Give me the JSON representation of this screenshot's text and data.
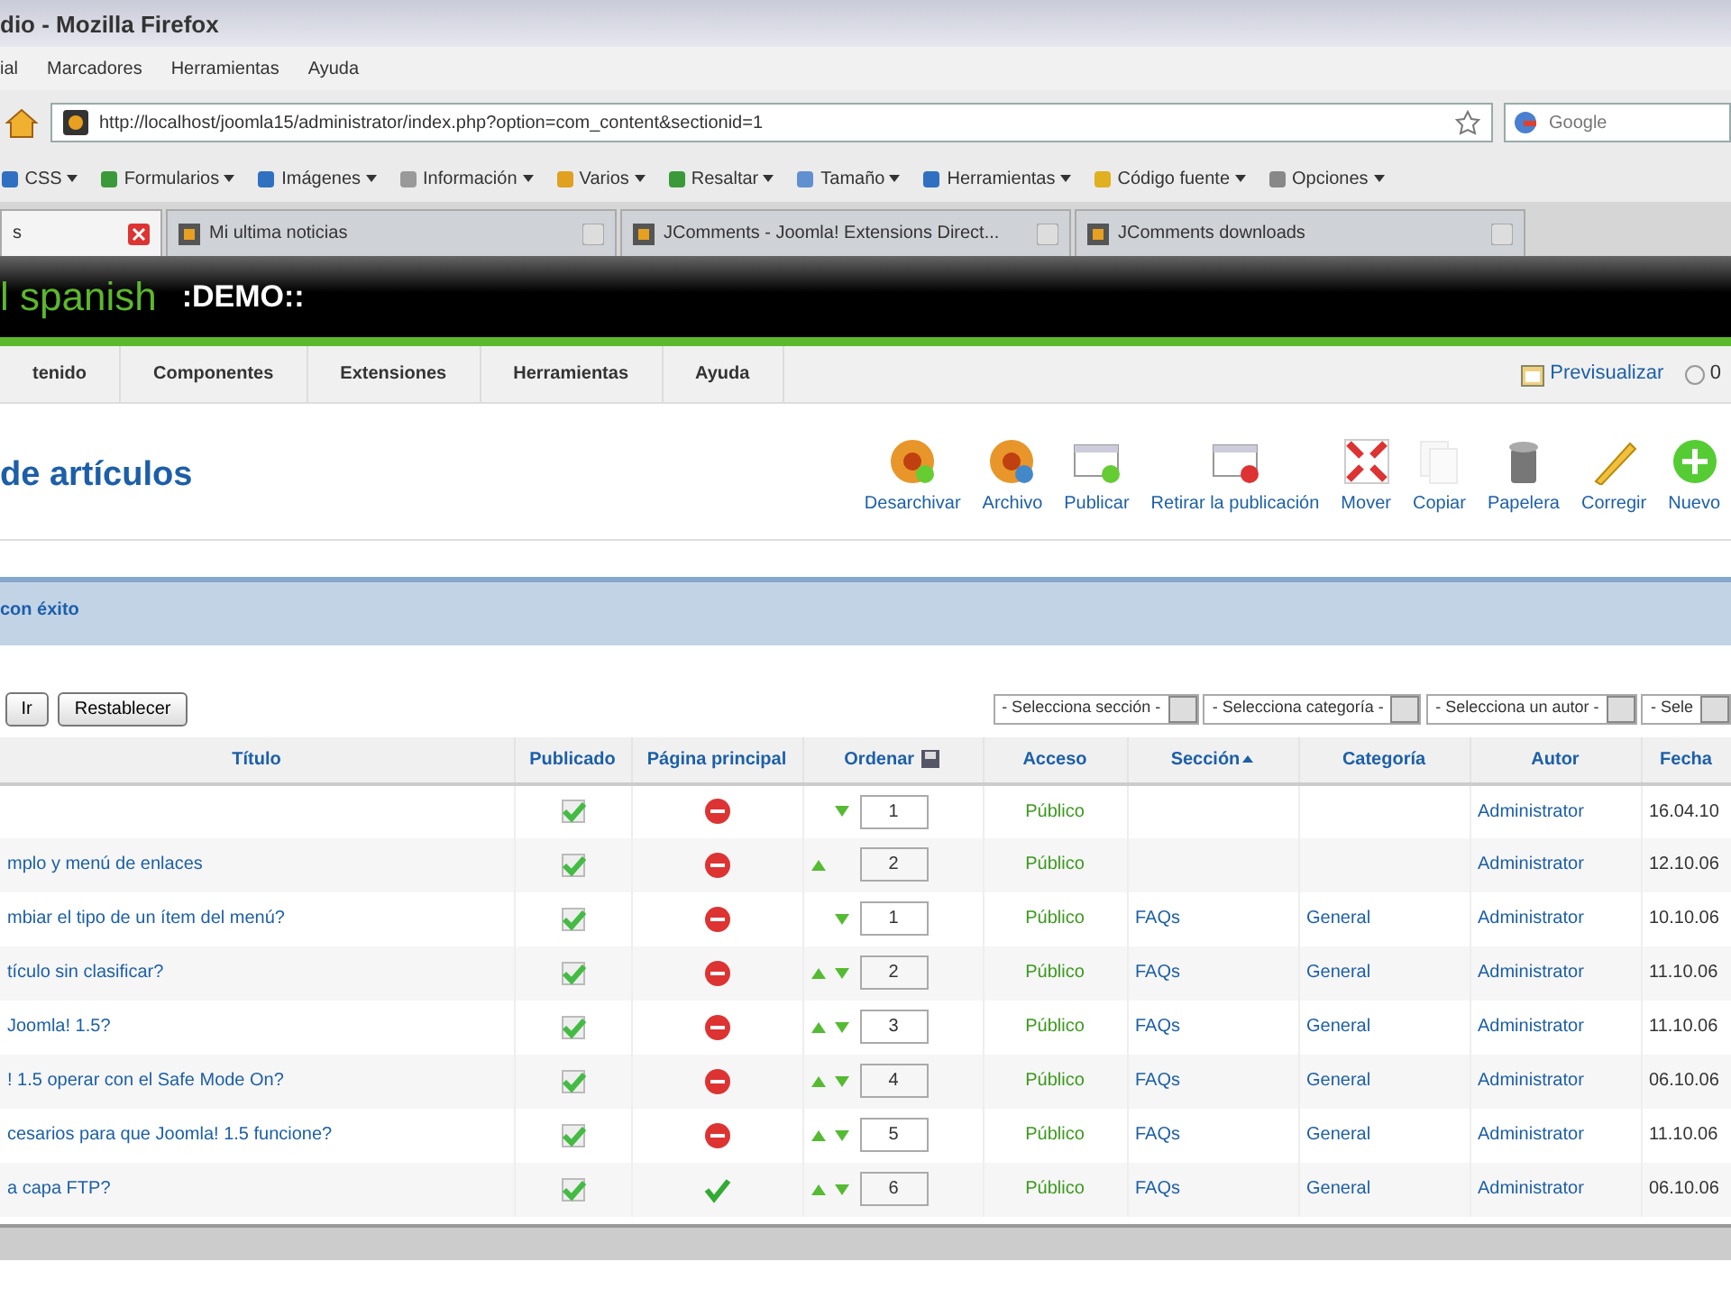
{
  "window": {
    "title": "dio - Mozilla Firefox"
  },
  "menu_bar": [
    "ial",
    "Marcadores",
    "Herramientas",
    "Ayuda"
  ],
  "address_bar": {
    "url": "http://localhost/joomla15/administrator/index.php?option=com_content&sectionid=1",
    "search_placeholder": "Google"
  },
  "bookmarks": [
    "CSS",
    "Formularios",
    "Imágenes",
    "Información",
    "Varios",
    "Resaltar",
    "Tamaño",
    "Herramientas",
    "Código fuente",
    "Opciones"
  ],
  "tabs": [
    {
      "label": "s",
      "selected": true
    },
    {
      "label": "Mi ultima noticias",
      "selected": false
    },
    {
      "label": "JComments - Joomla! Extensions Direct...",
      "selected": false
    },
    {
      "label": "JComments downloads",
      "selected": false
    }
  ],
  "site_header": {
    "logo": "l spanish",
    "tagline": ":DEMO::"
  },
  "admin_menu": [
    "tenido",
    "Componentes",
    "Extensiones",
    "Herramientas",
    "Ayuda"
  ],
  "header_links": {
    "preview": "Previsualizar",
    "messages": "0"
  },
  "page_title": "de artículos",
  "toolbar": [
    {
      "kind": "unarchive",
      "label": "Desarchivar",
      "disabled": false
    },
    {
      "kind": "archive",
      "label": "Archivo",
      "disabled": false
    },
    {
      "kind": "publish",
      "label": "Publicar",
      "disabled": false
    },
    {
      "kind": "unpublish",
      "label": "Retirar la publicación",
      "disabled": false
    },
    {
      "kind": "move",
      "label": "Mover",
      "disabled": false
    },
    {
      "kind": "copy",
      "label": "Copiar",
      "disabled": true
    },
    {
      "kind": "trash",
      "label": "Papelera",
      "disabled": false
    },
    {
      "kind": "edit",
      "label": "Corregir",
      "disabled": false
    },
    {
      "kind": "new",
      "label": "Nuevo",
      "disabled": false
    }
  ],
  "message": "con éxito",
  "filter": {
    "buttons": [
      "Ir",
      "Restablecer"
    ],
    "selects": [
      "- Selecciona sección -",
      "- Selecciona categoría -",
      "- Selecciona un autor -",
      "- Sele"
    ]
  },
  "table": {
    "columns": [
      {
        "label": "Título",
        "sorted": false
      },
      {
        "label": "Publicado",
        "sorted": false
      },
      {
        "label": "Página principal",
        "sorted": false
      },
      {
        "label": "Ordenar",
        "sorted": false
      },
      {
        "label": "Acceso",
        "sorted": false
      },
      {
        "label": "Sección",
        "sorted": true
      },
      {
        "label": "Categoría",
        "sorted": false
      },
      {
        "label": "Autor",
        "sorted": false
      },
      {
        "label": "Fecha",
        "sorted": false
      }
    ],
    "rows": [
      {
        "title": "",
        "published": true,
        "frontpage": false,
        "up": false,
        "down": true,
        "order": "1",
        "access": "Público",
        "section": "",
        "category": "",
        "author": "Administrator",
        "date": "16.04.10"
      },
      {
        "title": "mplo y menú de enlaces",
        "published": true,
        "frontpage": false,
        "up": true,
        "down": false,
        "order": "2",
        "access": "Público",
        "section": "",
        "category": "",
        "author": "Administrator",
        "date": "12.10.06"
      },
      {
        "title": "mbiar el tipo de un ítem del menú?",
        "published": true,
        "frontpage": false,
        "up": false,
        "down": true,
        "order": "1",
        "access": "Público",
        "section": "FAQs",
        "category": "General",
        "author": "Administrator",
        "date": "10.10.06"
      },
      {
        "title": "tículo sin clasificar?",
        "published": true,
        "frontpage": false,
        "up": true,
        "down": true,
        "order": "2",
        "access": "Público",
        "section": "FAQs",
        "category": "General",
        "author": "Administrator",
        "date": "11.10.06"
      },
      {
        "title": "Joomla! 1.5?",
        "published": true,
        "frontpage": false,
        "up": true,
        "down": true,
        "order": "3",
        "access": "Público",
        "section": "FAQs",
        "category": "General",
        "author": "Administrator",
        "date": "11.10.06"
      },
      {
        "title": "! 1.5 operar con el Safe Mode On?",
        "published": true,
        "frontpage": false,
        "up": true,
        "down": true,
        "order": "4",
        "access": "Público",
        "section": "FAQs",
        "category": "General",
        "author": "Administrator",
        "date": "06.10.06"
      },
      {
        "title": "cesarios para que Joomla! 1.5 funcione?",
        "published": true,
        "frontpage": false,
        "up": true,
        "down": true,
        "order": "5",
        "access": "Público",
        "section": "FAQs",
        "category": "General",
        "author": "Administrator",
        "date": "11.10.06"
      },
      {
        "title": "a capa FTP?",
        "published": true,
        "frontpage": true,
        "up": true,
        "down": true,
        "order": "6",
        "access": "Público",
        "section": "FAQs",
        "category": "General",
        "author": "Administrator",
        "date": "06.10.06"
      }
    ]
  }
}
